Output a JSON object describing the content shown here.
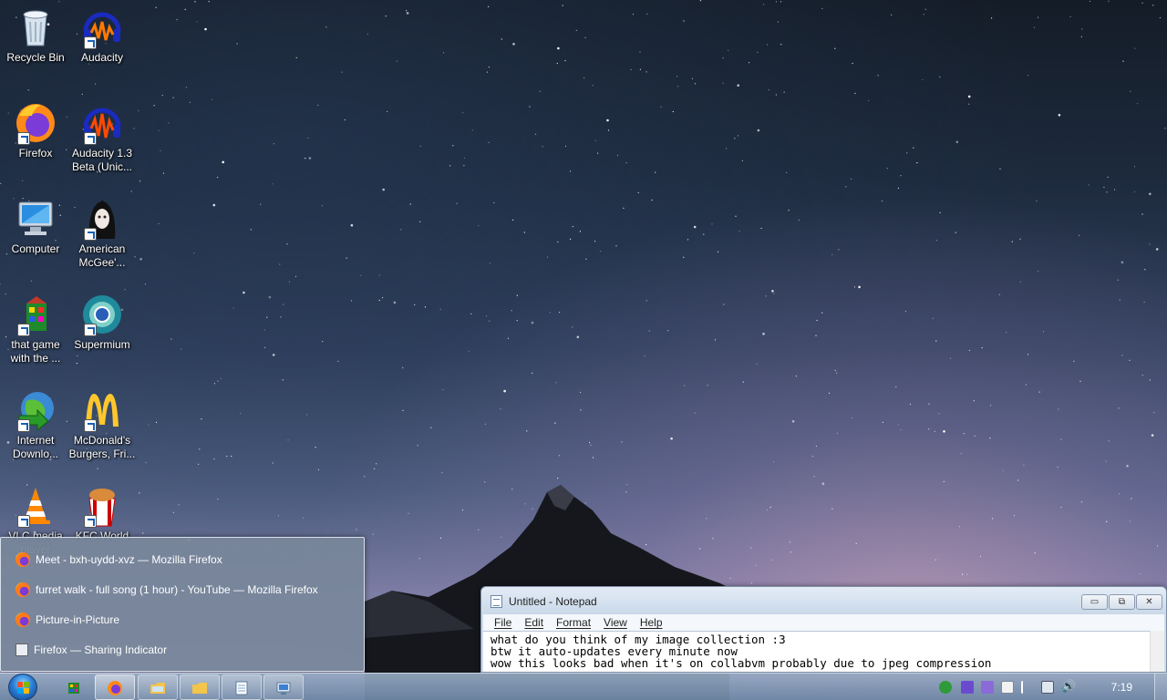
{
  "desktop": {
    "icons": [
      {
        "label": "Recycle Bin",
        "icon": "recycle-bin-icon"
      },
      {
        "label": "Audacity",
        "icon": "audacity-icon"
      },
      {
        "label": "Firefox",
        "icon": "firefox-icon"
      },
      {
        "label": "Audacity 1.3 Beta (Unic...",
        "icon": "audacity-beta-icon"
      },
      {
        "label": "Computer",
        "icon": "computer-icon"
      },
      {
        "label": "American McGee'...",
        "icon": "american-mcgee-icon"
      },
      {
        "label": "that game with the ...",
        "icon": "game-icon"
      },
      {
        "label": "Supermium",
        "icon": "supermium-icon"
      },
      {
        "label": "Internet Downlo...",
        "icon": "internet-download-icon"
      },
      {
        "label": "McDonald's Burgers, Fri...",
        "icon": "mcdonalds-icon"
      },
      {
        "label": "VLC media player",
        "icon": "vlc-icon"
      },
      {
        "label": "KFC World",
        "icon": "kfc-icon"
      }
    ]
  },
  "jumplist": {
    "items": [
      {
        "label": "Meet - bxh-uydd-xvz — Mozilla Firefox",
        "icon": "firefox-icon"
      },
      {
        "label": "furret walk - full song (1 hour) - YouTube — Mozilla Firefox",
        "icon": "firefox-icon"
      },
      {
        "label": "Picture-in-Picture",
        "icon": "firefox-icon"
      },
      {
        "label": "Firefox — Sharing Indicator",
        "icon": "window-icon"
      }
    ]
  },
  "notepad": {
    "title": "Untitled - Notepad",
    "menu": [
      "File",
      "Edit",
      "Format",
      "View",
      "Help"
    ],
    "text": "what do you think of my image collection :3\nbtw it auto-updates every minute now\nwow this looks bad when it's on collabvm probably due to jpeg compression",
    "controls": {
      "minimize": "▭",
      "maximize": "⧉",
      "close": "✕"
    }
  },
  "taskbar": {
    "clock": "7:19",
    "buttons": [
      {
        "name": "game",
        "icon": "game-icon"
      },
      {
        "name": "firefox",
        "icon": "firefox-icon"
      },
      {
        "name": "explorer",
        "icon": "folder-icon"
      },
      {
        "name": "folder",
        "icon": "folder-icon"
      },
      {
        "name": "notepad",
        "icon": "notepad-icon"
      },
      {
        "name": "remote",
        "icon": "remote-desktop-icon"
      }
    ],
    "tray_icons": [
      "network-green-icon",
      "microphone-icon",
      "screen-share-icon",
      "document-icon",
      "flag-icon",
      "network-icon",
      "volume-icon"
    ]
  },
  "colors": {
    "accent": "#2b7fd6",
    "jumplist_bg": "#78879b"
  }
}
